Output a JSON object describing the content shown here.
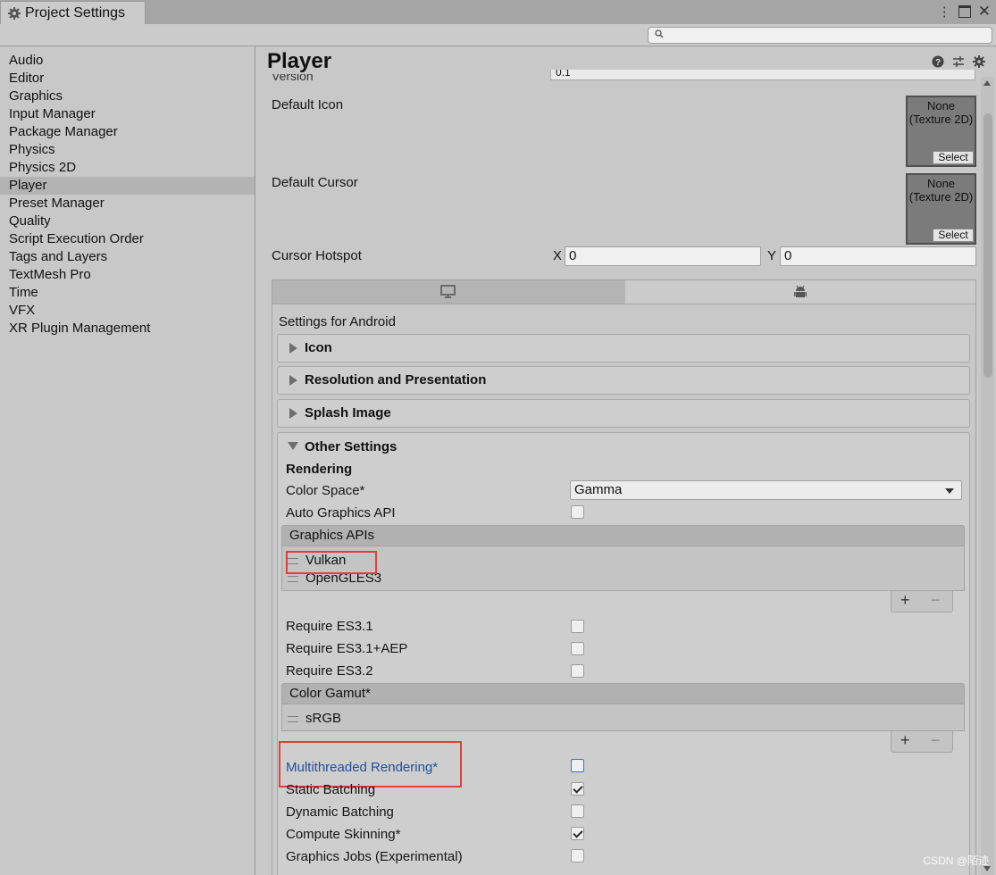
{
  "window": {
    "tab_title": "Project Settings"
  },
  "search": {
    "placeholder": ""
  },
  "sidebar": {
    "items": [
      {
        "label": "Audio"
      },
      {
        "label": "Editor"
      },
      {
        "label": "Graphics"
      },
      {
        "label": "Input Manager"
      },
      {
        "label": "Package Manager"
      },
      {
        "label": "Physics"
      },
      {
        "label": "Physics 2D"
      },
      {
        "label": "Player"
      },
      {
        "label": "Preset Manager"
      },
      {
        "label": "Quality"
      },
      {
        "label": "Script Execution Order"
      },
      {
        "label": "Tags and Layers"
      },
      {
        "label": "TextMesh Pro"
      },
      {
        "label": "Time"
      },
      {
        "label": "VFX"
      },
      {
        "label": "XR Plugin Management"
      }
    ],
    "selected": "Player"
  },
  "main": {
    "title": "Player",
    "version_label": "Version",
    "version_value": "0.1",
    "default_icon": {
      "label": "Default Icon",
      "value_line1": "None",
      "value_line2": "(Texture 2D)",
      "select": "Select"
    },
    "default_cursor": {
      "label": "Default Cursor",
      "value_line1": "None",
      "value_line2": "(Texture 2D)",
      "select": "Select"
    },
    "cursor_hotspot": {
      "label": "Cursor Hotspot",
      "x_label": "X",
      "x_value": "0",
      "y_label": "Y",
      "y_value": "0"
    },
    "platform": {
      "settings_for": "Settings for Android",
      "sections": {
        "icon": "Icon",
        "resolution": "Resolution and Presentation",
        "splash": "Splash Image",
        "other": "Other Settings"
      }
    },
    "rendering": {
      "heading": "Rendering",
      "color_space_label": "Color Space*",
      "color_space_value": "Gamma",
      "auto_graphics_api_label": "Auto Graphics API",
      "auto_graphics_api": false,
      "graphics_apis_header": "Graphics APIs",
      "graphics_apis": [
        "Vulkan",
        "OpenGLES3"
      ],
      "require_es31_label": "Require ES3.1",
      "require_es31aep_label": "Require ES3.1+AEP",
      "require_es32_label": "Require ES3.2",
      "color_gamut_header": "Color Gamut*",
      "color_gamut": [
        "sRGB"
      ],
      "multithreaded_label": "Multithreaded Rendering*",
      "static_batching_label": "Static Batching",
      "dynamic_batching_label": "Dynamic Batching",
      "compute_skinning_label": "Compute Skinning*",
      "graphics_jobs_label": "Graphics Jobs (Experimental)",
      "checks": {
        "require_es31": false,
        "require_es31aep": false,
        "require_es32": false,
        "multithreaded": false,
        "static_batching": true,
        "dynamic_batching": false,
        "compute_skinning": true,
        "graphics_jobs": false
      }
    }
  },
  "watermark": "CSDN @陌迹",
  "colors": {
    "highlight_box": "#e0403a",
    "link_blue": "#1f4fa0",
    "selected_item": "#b3b3b3"
  }
}
